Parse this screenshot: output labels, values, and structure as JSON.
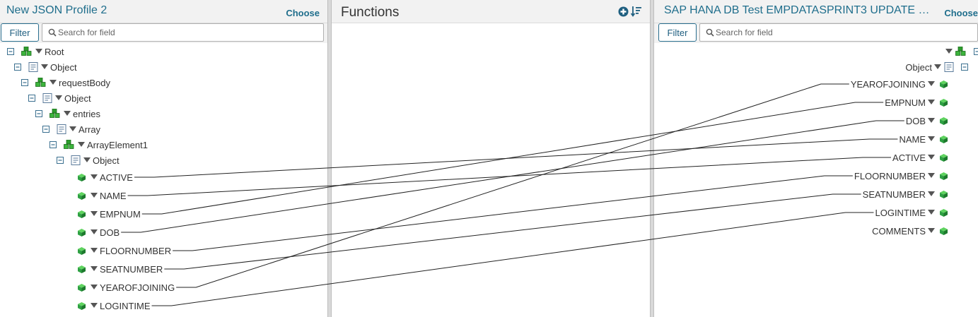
{
  "left": {
    "title": "New JSON Profile 2",
    "choose_label": "Choose",
    "filter_label": "Filter",
    "search_placeholder": "Search for field",
    "tree": [
      "Root",
      "Object",
      "requestBody",
      "Object",
      "entries",
      "Array",
      "ArrayElement1",
      "Object"
    ],
    "fields": [
      "ACTIVE",
      "NAME",
      "EMPNUM",
      "DOB",
      "FLOORNUMBER",
      "SEATNUMBER",
      "YEAROFJOINING",
      "LOGINTIME"
    ]
  },
  "middle": {
    "title": "Functions"
  },
  "right": {
    "title": "SAP HANA DB Test EMPDATASPRINT3 UPDATE Re...",
    "choose_label": "Choose",
    "filter_label": "Filter",
    "search_placeholder": "Search for field",
    "object_label": "Object",
    "fields": [
      "YEAROFJOINING",
      "EMPNUM",
      "DOB",
      "NAME",
      "ACTIVE",
      "FLOORNUMBER",
      "SEATNUMBER",
      "LOGINTIME",
      "COMMENTS"
    ]
  },
  "mappings": [
    {
      "from": "ACTIVE",
      "to": "NAME"
    },
    {
      "from": "NAME",
      "to": "ACTIVE"
    },
    {
      "from": "EMPNUM",
      "to": "EMPNUM"
    },
    {
      "from": "DOB",
      "to": "DOB"
    },
    {
      "from": "FLOORNUMBER",
      "to": "FLOORNUMBER"
    },
    {
      "from": "SEATNUMBER",
      "to": "SEATNUMBER"
    },
    {
      "from": "YEAROFJOINING",
      "to": "YEAROFJOINING"
    },
    {
      "from": "LOGINTIME",
      "to": "LOGINTIME"
    }
  ],
  "colors": {
    "accent": "#1f6e8c",
    "field_icon": "#2ea043",
    "line": "#222222"
  }
}
